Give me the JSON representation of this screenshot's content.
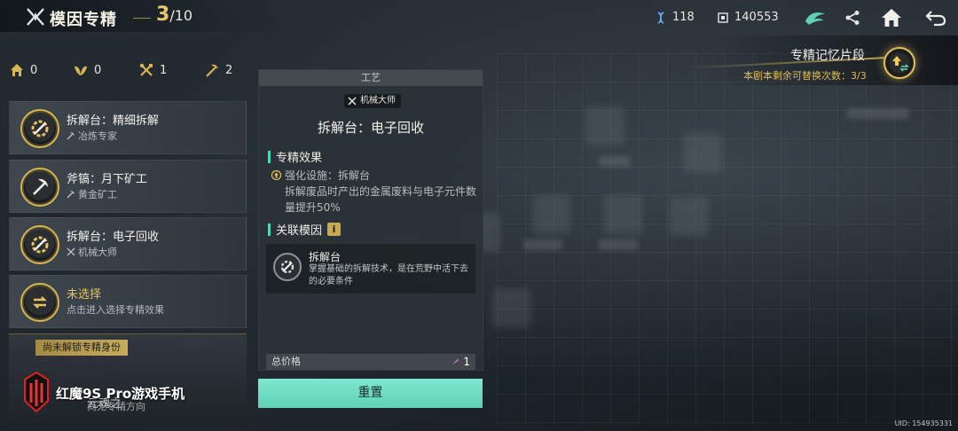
{
  "header": {
    "title": "模因专精",
    "progress_current": "3",
    "progress_total": "/10"
  },
  "resources": [
    {
      "icon": "gene-currency-icon",
      "value": "118"
    },
    {
      "icon": "chip-currency-icon",
      "value": "140553"
    }
  ],
  "toolbar": {
    "emblem": "faction-emblem-icon",
    "share": "share-icon",
    "home": "home-icon",
    "back": "back-icon"
  },
  "stats": [
    {
      "icon": "house-icon",
      "value": "0"
    },
    {
      "icon": "leaf-icon",
      "value": "0"
    },
    {
      "icon": "crossed-tools-icon",
      "value": "1"
    },
    {
      "icon": "pickaxe-icon",
      "value": "2"
    }
  ],
  "specializations": [
    {
      "name": "拆解台：精细拆解",
      "role": "冶炼专家",
      "role_icon": "pickaxe-icon"
    },
    {
      "name": "斧镐：月下矿工",
      "role": "黄金矿工",
      "role_icon": "pickaxe-icon"
    },
    {
      "name": "拆解台：电子回收",
      "role": "机械大师",
      "role_icon": "crossed-tools-icon"
    },
    {
      "name": "未选择",
      "role": "点击进入选择专精效果",
      "role_icon": ""
    }
  ],
  "locked": {
    "tag": "尚未解锁专精身份",
    "name": "元魂之",
    "sub": "尚无专精方向"
  },
  "watermark": {
    "text": "红魔9S Pro游戏手机"
  },
  "panel": {
    "header": "工艺",
    "role_tag": "机械大师",
    "title": "拆解台：电子回收",
    "effect_section": "专精效果",
    "effect_line": "强化设施：拆解台",
    "effect_desc": "拆解废品时产出的金属废料与电子元件数量提升50%",
    "related_section": "关联模因",
    "gene_name": "拆解台",
    "gene_desc": "掌握基础的拆解技术，是在荒野中活下去的必要条件",
    "price_label": "总价格",
    "price_value": "1",
    "reset_label": "重置"
  },
  "memory": {
    "title": "专精记忆片段",
    "sub": "本剧本剩余可替换次数：3/3"
  },
  "uid": "UID: 154935331",
  "colors": {
    "accent_gold": "#e5c25d",
    "accent_teal": "#5fd2b8"
  }
}
